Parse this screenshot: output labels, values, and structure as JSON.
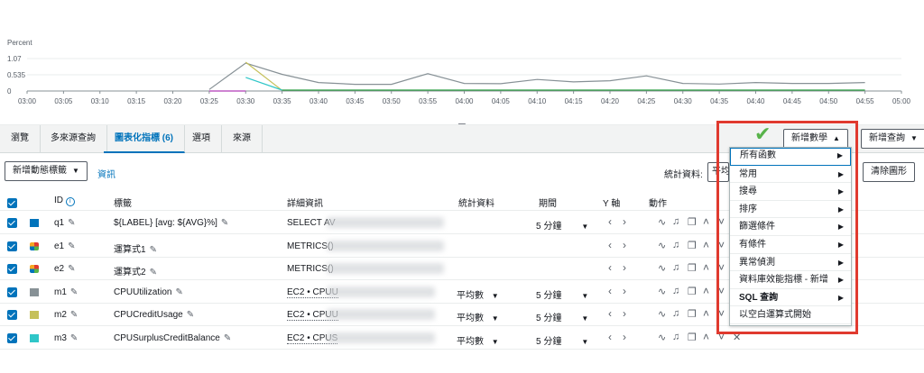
{
  "chart_data": {
    "type": "line",
    "ylabel": "Percent",
    "y_ticks": [
      "1.07",
      "0.535",
      "0"
    ],
    "ylim": [
      0,
      1.07
    ],
    "x_ticks": [
      "03:00",
      "03:05",
      "03:10",
      "03:15",
      "03:20",
      "03:25",
      "03:30",
      "03:35",
      "03:40",
      "03:45",
      "03:50",
      "03:55",
      "04:00",
      "04:05",
      "04:10",
      "04:15",
      "04:20",
      "04:25",
      "04:30",
      "04:35",
      "04:40",
      "04:45",
      "04:50",
      "04:55",
      "05:00"
    ],
    "series": [
      {
        "color": "#879196",
        "x": [
          "03:25",
          "03:30",
          "03:35",
          "03:40",
          "03:45",
          "03:50",
          "03:55",
          "04:00",
          "04:05",
          "04:10",
          "04:15",
          "04:20",
          "04:25",
          "04:30",
          "04:35",
          "04:40",
          "04:45",
          "04:50",
          "04:55"
        ],
        "values": [
          0.05,
          0.92,
          0.55,
          0.28,
          0.22,
          0.22,
          0.57,
          0.25,
          0.24,
          0.38,
          0.3,
          0.34,
          0.5,
          0.25,
          0.23,
          0.28,
          0.25,
          0.25,
          0.28
        ]
      },
      {
        "color": "#c5c05a",
        "x": [
          "03:30",
          "03:35"
        ],
        "values": [
          0.95,
          0.02
        ]
      },
      {
        "color": "#2fc6c8",
        "x": [
          "03:30",
          "03:35"
        ],
        "values": [
          0.45,
          0.03
        ]
      },
      {
        "color": "#2ea043",
        "x": [
          "03:35",
          "04:55"
        ],
        "values": [
          0.03,
          0.03
        ]
      },
      {
        "color": "#b03bb6",
        "x": [
          "03:25",
          "03:30"
        ],
        "values": [
          0.0,
          0.0
        ]
      }
    ]
  },
  "tabs": [
    "瀏覽",
    "多來源查詢",
    "圖表化指標 (6)",
    "選項",
    "來源"
  ],
  "buttons": {
    "add_math": "新增數學",
    "add_query": "新增查詢",
    "add_dynamic_label": "新增動態標籤",
    "clear_graph": "清除圖形"
  },
  "info_link": "資訊",
  "stat_label": "統計資料:",
  "stat_value": "平均",
  "table": {
    "headers": [
      "ID",
      "標籤",
      "詳細資訊",
      "統計資料",
      "期間",
      "Y 軸",
      "動作"
    ],
    "rows": [
      {
        "id": "q1",
        "label": "${LABEL} [avg: ${AVG}%]",
        "details": "SELECT AV",
        "stat": "",
        "period": "5 分鐘",
        "color": "#0073bb"
      },
      {
        "id": "e1",
        "label": "運算式1",
        "details": "METRICS()",
        "stat": "",
        "period": "",
        "color": "multi"
      },
      {
        "id": "e2",
        "label": "運算式2",
        "details": "METRICS()",
        "stat": "",
        "period": "",
        "color": "multi"
      },
      {
        "id": "m1",
        "label": "CPUUtilization",
        "details": "EC2 • CPUU",
        "stat": "平均數",
        "period": "5 分鐘",
        "color": "#879196"
      },
      {
        "id": "m2",
        "label": "CPUCreditUsage",
        "details": "EC2 • CPUU",
        "stat": "平均數",
        "period": "5 分鐘",
        "color": "#c5c05a"
      },
      {
        "id": "m3",
        "label": "CPUSurplusCreditBalance",
        "details": "EC2 • CPUS",
        "stat": "平均數",
        "period": "5 分鐘",
        "color": "#2fc6c8"
      }
    ]
  },
  "menu": {
    "items": [
      "所有函數",
      "常用",
      "搜尋",
      "排序",
      "篩選條件",
      "有條件",
      "異常偵測",
      "資料庫效能指標 - 新增",
      "SQL 查詢",
      "以空白運算式開始"
    ],
    "has_submenu": [
      true,
      true,
      true,
      true,
      true,
      true,
      true,
      true,
      true,
      false
    ]
  },
  "colors": {
    "accent": "#0073bb",
    "highlight_box": "#e03a2f",
    "checkmark": "#58b34a"
  }
}
